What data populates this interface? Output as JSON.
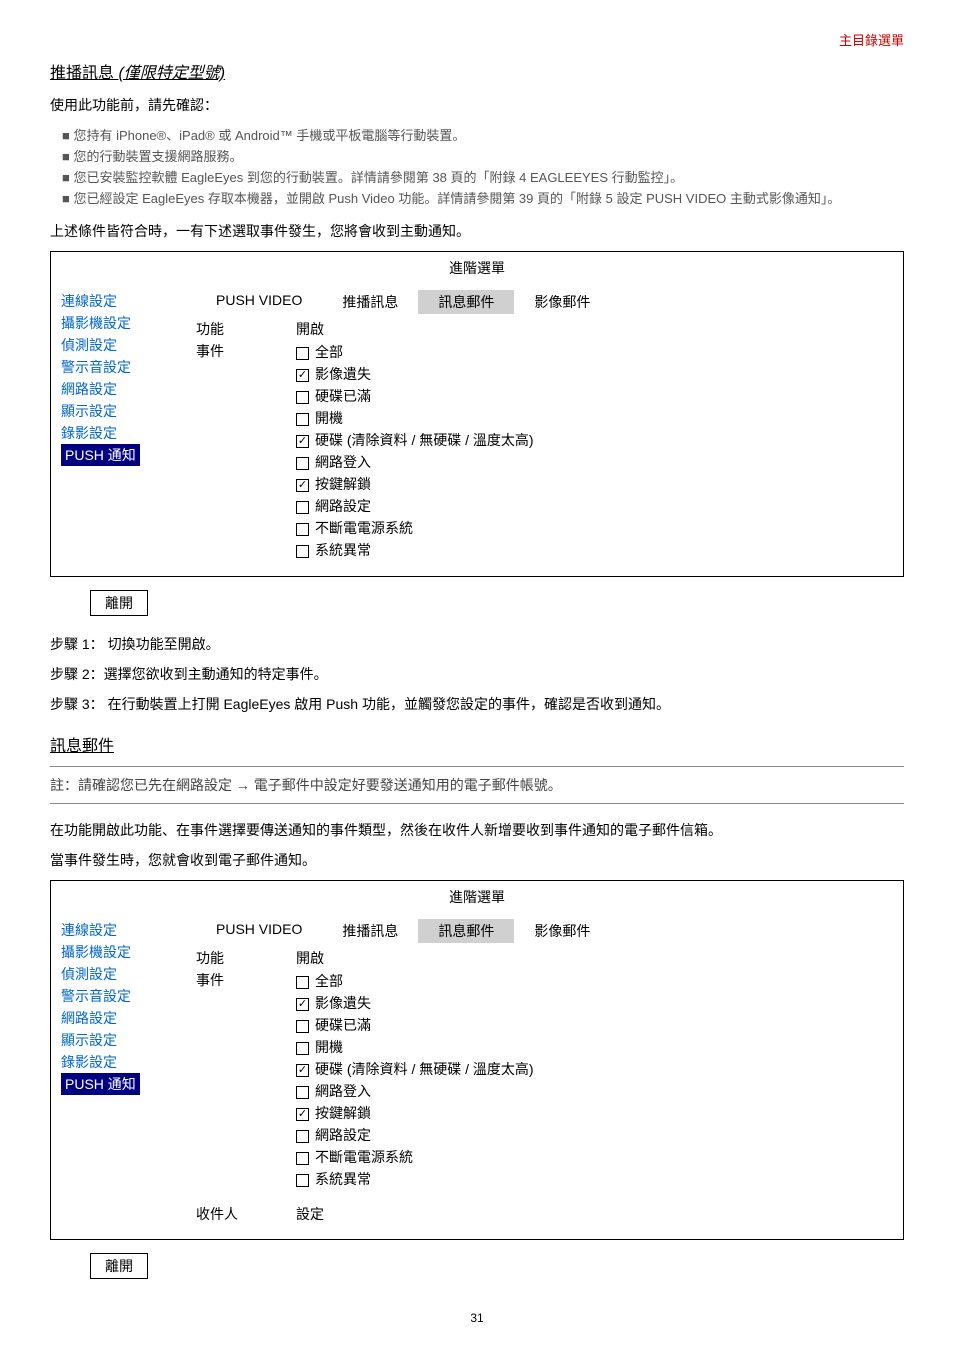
{
  "header_right": "主目錄選單",
  "push_title": "推播訊息",
  "push_title_sub": "(僅限特定型號)",
  "pre_text": "使用此功能前，請先確認：",
  "bullets": [
    "您持有 iPhone®、iPad® 或 Android™ 手機或平板電腦等行動裝置。",
    "您的行動裝置支援網路服務。",
    "您已安裝監控軟體 EagleEyes 到您的行動裝置。詳情請參閱第 38 頁的「附錄 4 EAGLEEYES 行動監控」。",
    "您已經設定 EagleEyes 存取本機器，並開啟 Push Video 功能。詳情請參閱第 39 頁的「附錄 5 設定 PUSH VIDEO 主動式影像通知」。"
  ],
  "post_text": "上述條件皆符合時，一有下述選取事件發生，您將會收到主動通知。",
  "menu_title": "進階選單",
  "sidebar_items": [
    "連線設定",
    "攝影機設定",
    "偵測設定",
    "警示音設定",
    "網路設定",
    "顯示設定",
    "錄影設定",
    "PUSH 通知"
  ],
  "tabs": {
    "push_video": "PUSH VIDEO",
    "push_msg": "推播訊息",
    "msg_mail": "訊息郵件",
    "img_mail": "影像郵件"
  },
  "labels": {
    "func": "功能",
    "event": "事件",
    "recipient": "收件人",
    "setting": "設定"
  },
  "func_value": "開啟",
  "events": [
    {
      "checked": false,
      "text": "全部"
    },
    {
      "checked": true,
      "text": "影像遺失"
    },
    {
      "checked": false,
      "text": "硬碟已滿"
    },
    {
      "checked": false,
      "text": "開機"
    },
    {
      "checked": true,
      "text": "硬碟 (清除資料 / 無硬碟 / 溫度太高)"
    },
    {
      "checked": false,
      "text": "網路登入"
    },
    {
      "checked": true,
      "text": "按鍵解鎖"
    },
    {
      "checked": false,
      "text": "網路設定"
    },
    {
      "checked": false,
      "text": "不斷電電源系統"
    },
    {
      "checked": false,
      "text": "系統異常"
    }
  ],
  "exit": "離開",
  "step1": "步驟 1： 切換功能至開啟。",
  "step2": "步驟 2：選擇您欲收到主動通知的特定事件。",
  "step3": "步驟 3： 在行動裝置上打開 EagleEyes 啟用 Push 功能，並觸發您設定的事件，確認是否收到通知。",
  "msg_mail_title": "訊息郵件",
  "note": "註：請確認您已先在網路設定 → 電子郵件中設定好要發送通知用的電子郵件帳號。",
  "para2": "在功能開啟此功能、在事件選擇要傳送通知的事件類型，然後在收件人新增要收到事件通知的電子郵件信箱。",
  "para3": "當事件發生時，您就會收到電子郵件通知。",
  "page_num": "31"
}
